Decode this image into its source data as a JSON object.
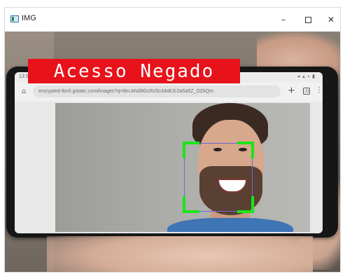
{
  "window": {
    "title": "IMG",
    "controls": {
      "minimize": "–",
      "close": "✕"
    }
  },
  "status_label": {
    "text": "Acesso Negado",
    "color": "#e8121a"
  },
  "phone": {
    "status_time": "13:57",
    "status_icons": "◂ ▴ ▪ ▮",
    "url": "encrypted-tbn0.gstatic.com/images?q=tbn:ANd9GcRz5oJdsBJL0a5a5Z_OZkQm",
    "tabs_count": ":D"
  },
  "detection": {
    "box_color": "#19e619",
    "outline_color": "#6a6ad8"
  },
  "icons": {
    "app": "window-app-icon",
    "home": "home-icon",
    "new_tab": "plus-icon",
    "tabs": "tabs-icon",
    "menu": "more-vert-icon"
  }
}
